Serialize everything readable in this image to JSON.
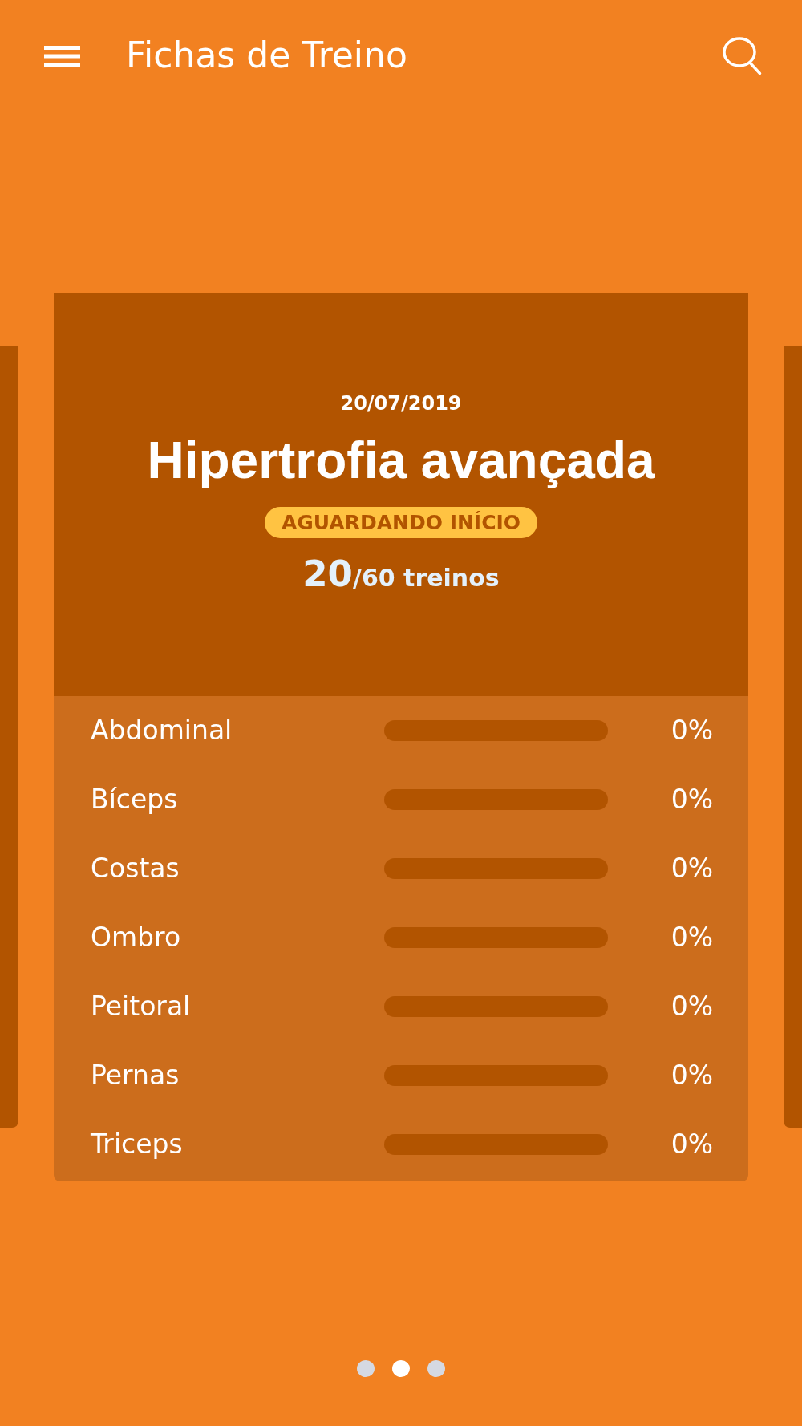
{
  "app_bar": {
    "title": "Fichas de Treino"
  },
  "workout_card": {
    "date": "20/07/2019",
    "title": "Hipertrofia avançada",
    "status": "AGUARDANDO INÍCIO",
    "completed": "20",
    "total": "/60 treinos",
    "muscle_groups": [
      {
        "name": "Abdominal",
        "level": 0,
        "reading": "0%"
      },
      {
        "name": "Bíceps",
        "level": 0,
        "reading": "0%"
      },
      {
        "name": "Costas",
        "level": 0,
        "reading": "0%"
      },
      {
        "name": "Ombro",
        "level": 0,
        "reading": "0%"
      },
      {
        "name": "Peitoral",
        "level": 0,
        "reading": "0%"
      },
      {
        "name": "Pernas",
        "level": 0,
        "reading": "0%"
      },
      {
        "name": "Triceps",
        "level": 0,
        "reading": "0%"
      }
    ]
  },
  "page_indicator": [
    {
      "selected": false
    },
    {
      "selected": true
    },
    {
      "selected": false
    }
  ]
}
